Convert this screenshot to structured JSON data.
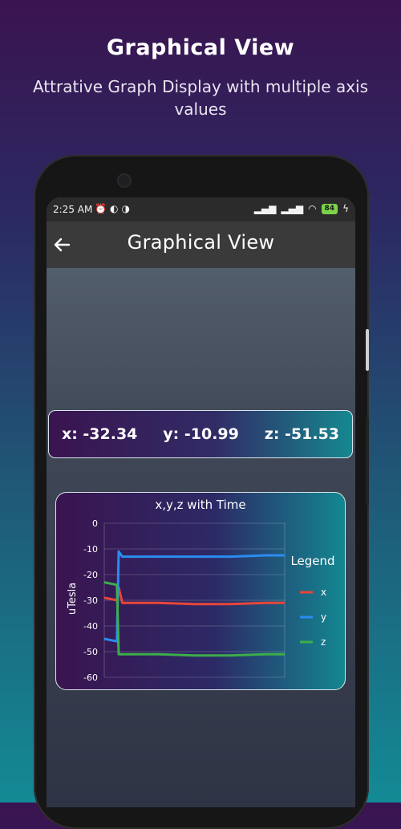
{
  "promo": {
    "title": "Graphical View",
    "subtitle": "Attrative Graph Display with multiple axis values"
  },
  "status_bar": {
    "time": "2:25 AM",
    "battery": "84",
    "left_icons": [
      "alarm-icon",
      "app-icon",
      "app-icon"
    ],
    "right_icons": [
      "signal-icon",
      "signal-icon",
      "wifi-icon",
      "battery-icon",
      "charging-icon"
    ]
  },
  "app_bar": {
    "title": "Graphical View",
    "back_icon": "arrow-left-icon"
  },
  "readings": {
    "x": "x: -32.34",
    "y": "y: -10.99",
    "z": "z: -51.53"
  },
  "colors": {
    "x": "#e8453c",
    "y": "#2a8cf0",
    "z": "#3dae4a"
  },
  "chart_data": {
    "type": "line",
    "title": "x,y,z with Time",
    "xlabel": "",
    "ylabel": "uTesla",
    "ylim": [
      -60,
      0
    ],
    "yticks": [
      0,
      -10,
      -20,
      -30,
      -40,
      -50,
      -60
    ],
    "grid": true,
    "legend_title": "Legend",
    "legend_position": "right",
    "series": [
      {
        "name": "x",
        "color": "#e8453c",
        "x": [
          0,
          0.07,
          0.08,
          0.1,
          0.3,
          0.5,
          0.7,
          0.9,
          1.0
        ],
        "values": [
          -29,
          -30,
          -25,
          -31,
          -31,
          -31.5,
          -31.5,
          -31,
          -31
        ]
      },
      {
        "name": "y",
        "color": "#2a8cf0",
        "x": [
          0,
          0.07,
          0.08,
          0.1,
          0.3,
          0.5,
          0.7,
          0.9,
          1.0
        ],
        "values": [
          -45,
          -46,
          -11,
          -13,
          -13,
          -13,
          -13,
          -12.5,
          -12.5
        ]
      },
      {
        "name": "z",
        "color": "#3dae4a",
        "x": [
          0,
          0.07,
          0.08,
          0.1,
          0.3,
          0.5,
          0.7,
          0.9,
          1.0
        ],
        "values": [
          -23,
          -24,
          -51,
          -51,
          -51,
          -51.5,
          -51.5,
          -51,
          -51
        ]
      }
    ]
  }
}
